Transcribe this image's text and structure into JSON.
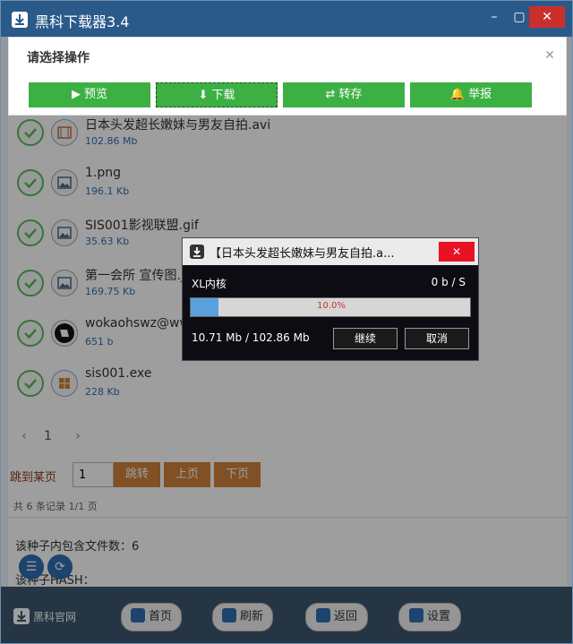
{
  "window": {
    "title": "黑科下载器3.4",
    "controls": {
      "minimize": "–",
      "maximize": "▢",
      "close": "✕"
    }
  },
  "files": [
    {
      "name": "日本头发超长嫩妹与男友自拍.avi",
      "size": "102.86 Mb",
      "icon": "film-icon"
    },
    {
      "name": "1.png",
      "size": "196.1 Kb",
      "icon": "image-icon"
    },
    {
      "name": "SIS001影视联盟.gif",
      "size": "35.63 Kb",
      "icon": "image-icon"
    },
    {
      "name": "第一会所 宣传图.jpg",
      "size": "169.75 Kb",
      "icon": "image-icon"
    },
    {
      "name": "wokaohswz@www",
      "size": "651 b",
      "icon": "book-icon"
    },
    {
      "name": "sis001.exe",
      "size": "228 Kb",
      "icon": "windows-icon"
    }
  ],
  "pager": {
    "prev": "‹",
    "current_page": "1",
    "next": "›",
    "jump_label": "跳到某页",
    "jump_value": "1",
    "jump_button": "跳转",
    "prev_page_button": "上页",
    "next_page_button": "下页",
    "record_info": "共 6 条记录 1/1 页"
  },
  "torrent_info": {
    "file_count_text": "该种子内包含文件数：6",
    "hash_text": "该种子HASH："
  },
  "bottom": {
    "brand": "黑科官网",
    "home": "首页",
    "refresh": "刷新",
    "back": "返回",
    "settings": "设置"
  },
  "action_panel": {
    "title": "请选择操作",
    "close": "✕",
    "preview": "预览",
    "download": "下载",
    "transfer": "转存",
    "report": "举报"
  },
  "dialog": {
    "title": "【日本头发超长嫩妹与男友自拍.a...",
    "close": "✕",
    "engine": "XL内核",
    "speed": "0 b / S",
    "progress_fraction": 0.1,
    "progress_text": "10.0%",
    "bytes": "10.71 Mb / 102.86 Mb",
    "continue": "继续",
    "cancel": "取消"
  },
  "colors": {
    "titlebar": "#2a5a8a",
    "action_green": "#3cb043",
    "pager_orange": "#d0813a",
    "progress_fill": "#5aa0dc",
    "close_red": "#e81123"
  }
}
